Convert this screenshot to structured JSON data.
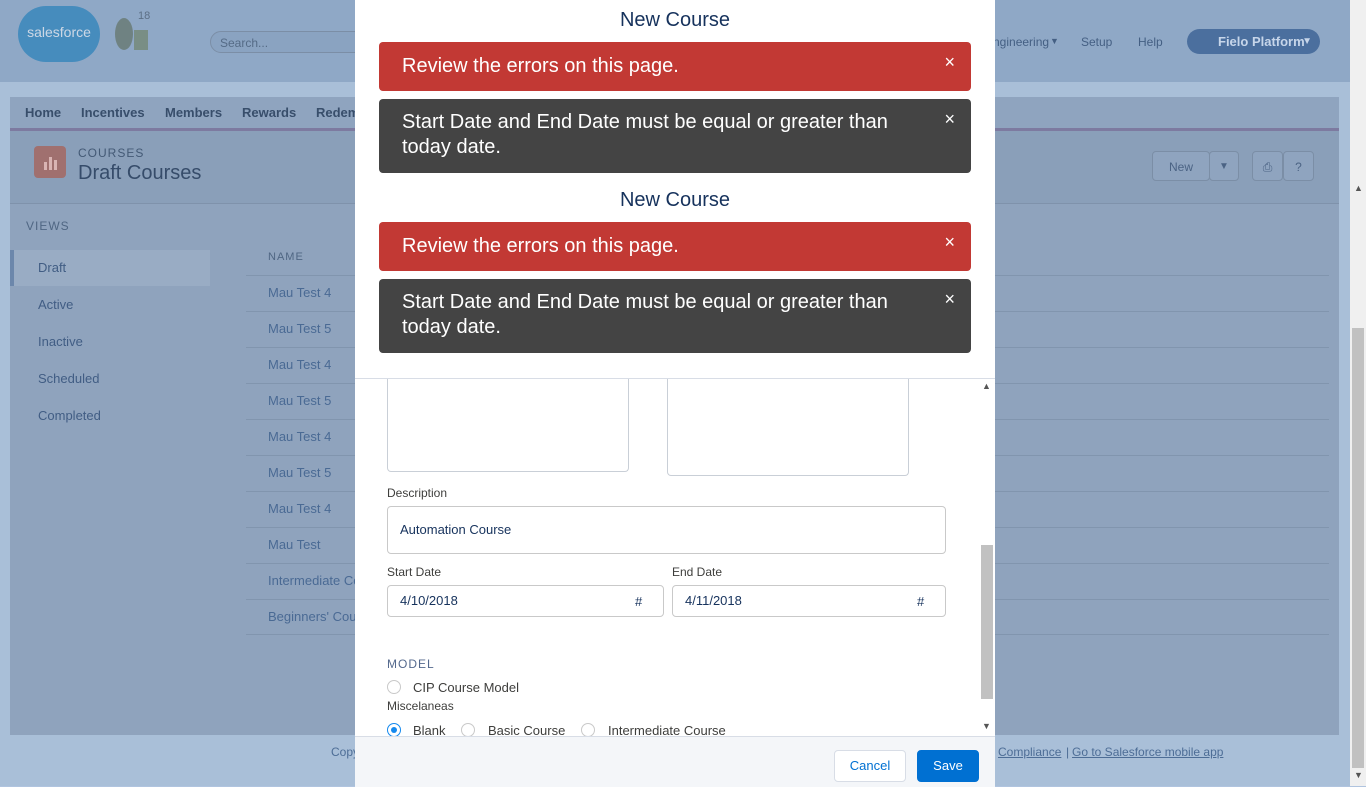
{
  "background": {
    "header": {
      "logo_text": "salesforce",
      "badge": "18",
      "search_placeholder": "Search...",
      "links": [
        "Engineering",
        "Setup",
        "Help"
      ],
      "app_switcher": "Fielo Platform"
    },
    "nav_items": [
      "Home",
      "Incentives",
      "Members",
      "Rewards",
      "Redem"
    ],
    "page": {
      "object_label": "COURSES",
      "title": "Draft Courses",
      "new_button": "New",
      "help_button": "?"
    },
    "views": {
      "label": "VIEWS",
      "items": [
        "Draft",
        "Active",
        "Inactive",
        "Scheduled",
        "Completed"
      ]
    },
    "list": {
      "column_header": "NAME",
      "rows": [
        "Mau Test 4",
        "Mau Test 5",
        "Mau Test 4",
        "Mau Test 5",
        "Mau Test 4",
        "Mau Test 5",
        "Mau Test 4",
        "Mau Test",
        "Intermediate Co",
        "Beginners' Cou"
      ]
    },
    "footer": {
      "left": "Copy",
      "links": [
        "Compliance",
        "Go to Salesforce mobile app"
      ],
      "separator": "|"
    }
  },
  "modal": {
    "title": "New Course",
    "toasts": [
      {
        "type": "error",
        "message": "Review the errors on this page."
      },
      {
        "type": "info",
        "message": "Start Date and End Date must be equal or greater than today date."
      }
    ],
    "form": {
      "description_label": "Description",
      "description_value": "Automation Course",
      "start_date_label": "Start Date",
      "start_date_value": "4/10/2018",
      "end_date_label": "End Date",
      "end_date_value": "4/11/2018",
      "date_icon": "#",
      "model_section": "MODEL",
      "model_options": [
        {
          "label": "CIP Course Model",
          "checked": false
        }
      ],
      "misc_label": "Miscelaneas",
      "misc_options": [
        {
          "label": "Blank",
          "checked": true
        },
        {
          "label": "Basic Course",
          "checked": false
        },
        {
          "label": "Intermediate Course",
          "checked": false
        }
      ]
    },
    "buttons": {
      "cancel": "Cancel",
      "save": "Save"
    },
    "close_glyph": "×"
  },
  "colors": {
    "error_toast": "#c23934",
    "info_toast": "#444444",
    "brand": "#0070d2",
    "title": "#16325c"
  }
}
